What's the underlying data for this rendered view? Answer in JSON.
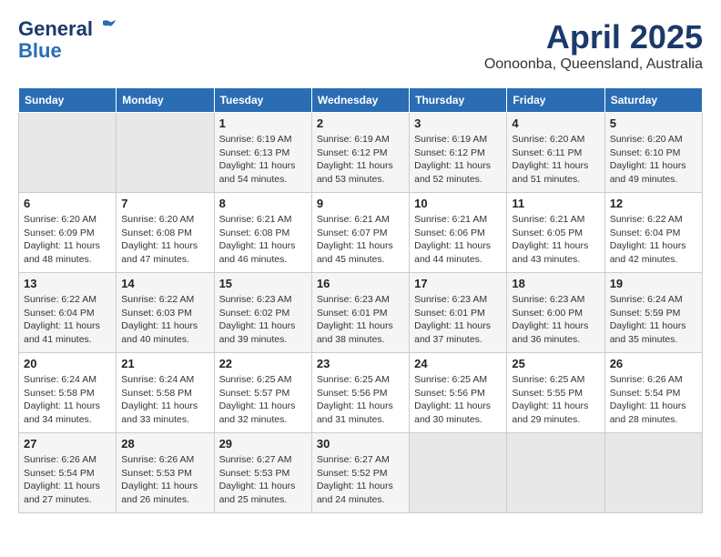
{
  "header": {
    "logo_line1": "General",
    "logo_line2": "Blue",
    "month": "April 2025",
    "location": "Oonoonba, Queensland, Australia"
  },
  "days_of_week": [
    "Sunday",
    "Monday",
    "Tuesday",
    "Wednesday",
    "Thursday",
    "Friday",
    "Saturday"
  ],
  "weeks": [
    [
      {
        "day": "",
        "info": ""
      },
      {
        "day": "",
        "info": ""
      },
      {
        "day": "1",
        "info": "Sunrise: 6:19 AM\nSunset: 6:13 PM\nDaylight: 11 hours and 54 minutes."
      },
      {
        "day": "2",
        "info": "Sunrise: 6:19 AM\nSunset: 6:12 PM\nDaylight: 11 hours and 53 minutes."
      },
      {
        "day": "3",
        "info": "Sunrise: 6:19 AM\nSunset: 6:12 PM\nDaylight: 11 hours and 52 minutes."
      },
      {
        "day": "4",
        "info": "Sunrise: 6:20 AM\nSunset: 6:11 PM\nDaylight: 11 hours and 51 minutes."
      },
      {
        "day": "5",
        "info": "Sunrise: 6:20 AM\nSunset: 6:10 PM\nDaylight: 11 hours and 49 minutes."
      }
    ],
    [
      {
        "day": "6",
        "info": "Sunrise: 6:20 AM\nSunset: 6:09 PM\nDaylight: 11 hours and 48 minutes."
      },
      {
        "day": "7",
        "info": "Sunrise: 6:20 AM\nSunset: 6:08 PM\nDaylight: 11 hours and 47 minutes."
      },
      {
        "day": "8",
        "info": "Sunrise: 6:21 AM\nSunset: 6:08 PM\nDaylight: 11 hours and 46 minutes."
      },
      {
        "day": "9",
        "info": "Sunrise: 6:21 AM\nSunset: 6:07 PM\nDaylight: 11 hours and 45 minutes."
      },
      {
        "day": "10",
        "info": "Sunrise: 6:21 AM\nSunset: 6:06 PM\nDaylight: 11 hours and 44 minutes."
      },
      {
        "day": "11",
        "info": "Sunrise: 6:21 AM\nSunset: 6:05 PM\nDaylight: 11 hours and 43 minutes."
      },
      {
        "day": "12",
        "info": "Sunrise: 6:22 AM\nSunset: 6:04 PM\nDaylight: 11 hours and 42 minutes."
      }
    ],
    [
      {
        "day": "13",
        "info": "Sunrise: 6:22 AM\nSunset: 6:04 PM\nDaylight: 11 hours and 41 minutes."
      },
      {
        "day": "14",
        "info": "Sunrise: 6:22 AM\nSunset: 6:03 PM\nDaylight: 11 hours and 40 minutes."
      },
      {
        "day": "15",
        "info": "Sunrise: 6:23 AM\nSunset: 6:02 PM\nDaylight: 11 hours and 39 minutes."
      },
      {
        "day": "16",
        "info": "Sunrise: 6:23 AM\nSunset: 6:01 PM\nDaylight: 11 hours and 38 minutes."
      },
      {
        "day": "17",
        "info": "Sunrise: 6:23 AM\nSunset: 6:01 PM\nDaylight: 11 hours and 37 minutes."
      },
      {
        "day": "18",
        "info": "Sunrise: 6:23 AM\nSunset: 6:00 PM\nDaylight: 11 hours and 36 minutes."
      },
      {
        "day": "19",
        "info": "Sunrise: 6:24 AM\nSunset: 5:59 PM\nDaylight: 11 hours and 35 minutes."
      }
    ],
    [
      {
        "day": "20",
        "info": "Sunrise: 6:24 AM\nSunset: 5:58 PM\nDaylight: 11 hours and 34 minutes."
      },
      {
        "day": "21",
        "info": "Sunrise: 6:24 AM\nSunset: 5:58 PM\nDaylight: 11 hours and 33 minutes."
      },
      {
        "day": "22",
        "info": "Sunrise: 6:25 AM\nSunset: 5:57 PM\nDaylight: 11 hours and 32 minutes."
      },
      {
        "day": "23",
        "info": "Sunrise: 6:25 AM\nSunset: 5:56 PM\nDaylight: 11 hours and 31 minutes."
      },
      {
        "day": "24",
        "info": "Sunrise: 6:25 AM\nSunset: 5:56 PM\nDaylight: 11 hours and 30 minutes."
      },
      {
        "day": "25",
        "info": "Sunrise: 6:25 AM\nSunset: 5:55 PM\nDaylight: 11 hours and 29 minutes."
      },
      {
        "day": "26",
        "info": "Sunrise: 6:26 AM\nSunset: 5:54 PM\nDaylight: 11 hours and 28 minutes."
      }
    ],
    [
      {
        "day": "27",
        "info": "Sunrise: 6:26 AM\nSunset: 5:54 PM\nDaylight: 11 hours and 27 minutes."
      },
      {
        "day": "28",
        "info": "Sunrise: 6:26 AM\nSunset: 5:53 PM\nDaylight: 11 hours and 26 minutes."
      },
      {
        "day": "29",
        "info": "Sunrise: 6:27 AM\nSunset: 5:53 PM\nDaylight: 11 hours and 25 minutes."
      },
      {
        "day": "30",
        "info": "Sunrise: 6:27 AM\nSunset: 5:52 PM\nDaylight: 11 hours and 24 minutes."
      },
      {
        "day": "",
        "info": ""
      },
      {
        "day": "",
        "info": ""
      },
      {
        "day": "",
        "info": ""
      }
    ]
  ]
}
